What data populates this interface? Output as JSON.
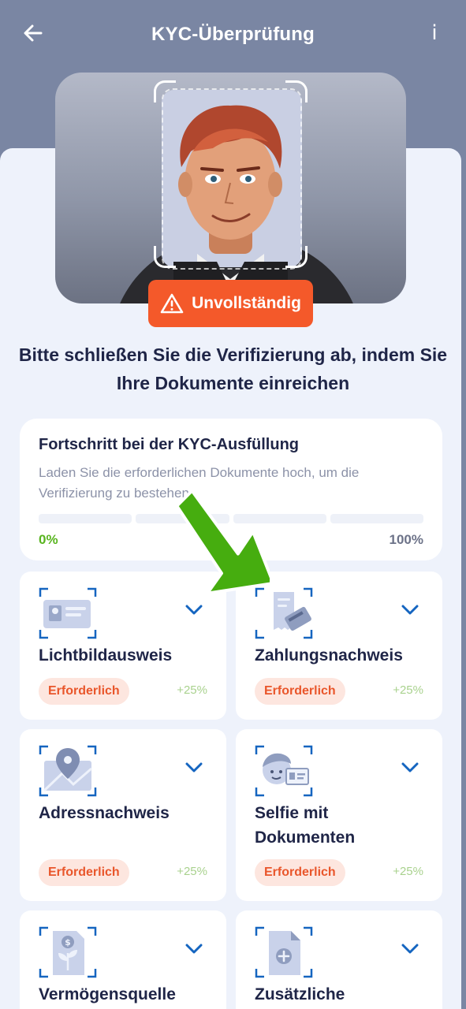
{
  "header": {
    "title": "KYC-Überprüfung",
    "back_icon": "arrow-left-icon",
    "info_label": "i"
  },
  "status": {
    "label": "Unvollständig",
    "color": "#f4592a",
    "icon": "warning-icon"
  },
  "headline": "Bitte schließen Sie die Verifizierung ab, indem Sie Ihre Dokumente einreichen",
  "progress": {
    "title": "Fortschritt bei der KYC-Ausfüllung",
    "subtitle": "Laden Sie die erforderlichen Dokumente hoch, um die Verifizierung zu bestehen",
    "min_label": "0%",
    "max_label": "100%",
    "value_fraction": 0
  },
  "documents": [
    {
      "title": "Lichtbildausweis",
      "badge": "Erforderlich",
      "weight": "+25%",
      "icon": "id-card-icon"
    },
    {
      "title": "Zahlungsnachweis",
      "badge": "Erforderlich",
      "weight": "+25%",
      "icon": "receipt-card-icon"
    },
    {
      "title": "Adressnachweis",
      "badge": "Erforderlich",
      "weight": "+25%",
      "icon": "map-pin-icon"
    },
    {
      "title": "Selfie mit Dokumenten",
      "badge": "Erforderlich",
      "weight": "+25%",
      "icon": "selfie-id-icon"
    },
    {
      "title": "Vermögensquelle",
      "icon": "money-plant-icon"
    },
    {
      "title": "Zusätzliche",
      "icon": "add-document-icon"
    }
  ],
  "colors": {
    "accent_blue": "#1565c0",
    "header_bg": "#7a86a3",
    "required_text": "#e9562b",
    "success_green": "#58b41e"
  }
}
